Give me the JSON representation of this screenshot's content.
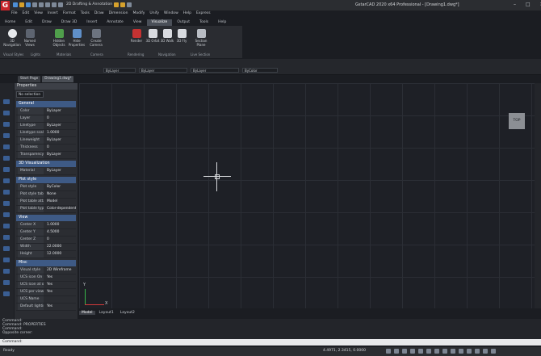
{
  "window": {
    "title": "GstarCAD 2020 x64 Professional - [Drawing1.dwg*]",
    "min": "–",
    "max": "□",
    "close": "✕"
  },
  "qat": {
    "workspace": "2D Drafting & Annotation"
  },
  "menu": [
    "File",
    "Edit",
    "View",
    "Insert",
    "Format",
    "Tools",
    "Draw",
    "Dimension",
    "Modify",
    "Unify",
    "Window",
    "Help",
    "Express"
  ],
  "ribbon_tabs": [
    "Home",
    "Edit",
    "Draw",
    "Draw 3D",
    "Insert",
    "Annotate",
    "View",
    "Visualize",
    "Output",
    "Tools",
    "Help"
  ],
  "ribbon_active": "Visualize",
  "ribbon": {
    "buttons": [
      "3D Navigation",
      "Named Views",
      "Hidden Objects",
      "Hide Properties",
      "Create Camera",
      "Render",
      "3D Orbit",
      "3D Walk",
      "3D Fly",
      "Free Orbit",
      "Section Plane"
    ],
    "groups": [
      "Visual Styles",
      "Lights",
      "Materials",
      "Camera",
      "Rendering",
      "Navigation",
      "Live Section"
    ]
  },
  "toolbar": {
    "color": "ByLayer",
    "linetype": "ByLayer",
    "lineweight": "ByLayer",
    "plotstyle": "ByColor",
    "layer": "0"
  },
  "doc_tabs": [
    "Start Page",
    "Drawing1.dwg*"
  ],
  "properties": {
    "title": "Properties",
    "selection": "No selection",
    "sections": [
      {
        "name": "General",
        "rows": [
          [
            "Color",
            "ByLayer"
          ],
          [
            "Layer",
            "0"
          ],
          [
            "Linetype",
            "ByLayer"
          ],
          [
            "Linetype scale",
            "1.0000"
          ],
          [
            "Lineweight",
            "ByLayer"
          ],
          [
            "Thickness",
            "0"
          ],
          [
            "Transparency",
            "ByLayer"
          ]
        ]
      },
      {
        "name": "3D Visualization",
        "rows": [
          [
            "Material",
            "ByLayer"
          ]
        ]
      },
      {
        "name": "Plot style",
        "rows": [
          [
            "Plot style",
            "ByColor"
          ],
          [
            "Plot style table",
            "None"
          ],
          [
            "Plot table attach",
            "Model"
          ],
          [
            "Plot table type",
            "Color-dependent"
          ]
        ]
      },
      {
        "name": "View",
        "rows": [
          [
            "Center X",
            "1.0000"
          ],
          [
            "Center Y",
            "4.5000"
          ],
          [
            "Center Z",
            "0"
          ],
          [
            "Width",
            "22.0000"
          ],
          [
            "Height",
            "12.0000"
          ]
        ]
      },
      {
        "name": "Misc",
        "rows": [
          [
            "Visual style",
            "2D Wireframe"
          ],
          [
            "UCS icon On",
            "Yes"
          ],
          [
            "UCS icon at origin",
            "Yes"
          ],
          [
            "UCS per viewport",
            "Yes"
          ],
          [
            "UCS Name",
            ""
          ],
          [
            "Default lighting",
            "Yes"
          ]
        ]
      }
    ]
  },
  "canvas": {
    "viewcube": "TOP",
    "ucs_x": "X",
    "ucs_y": "Y"
  },
  "layout_tabs": [
    "Model",
    "Layout1",
    "Layout2"
  ],
  "command": {
    "history": [
      "Command:",
      "Command: PROPERTIES",
      "Command:",
      "Opposite corner:"
    ],
    "prompt": "Command:"
  },
  "status": {
    "left": "Ready",
    "coords": "4.4971, 2.3415, 0.0000"
  }
}
